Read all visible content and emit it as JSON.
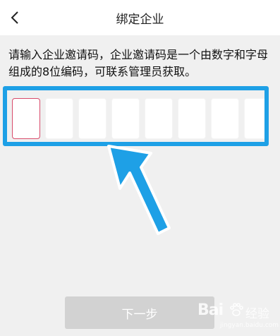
{
  "header": {
    "title": "绑定企业",
    "back_icon": "chevron-left-icon"
  },
  "instruction": "请输入企业邀请码，企业邀请码是一个由数字和字母组成的8位编码，可联系管理员获取。",
  "invite_code": {
    "length": 8,
    "values": [
      "",
      "",
      "",
      "",
      "",
      "",
      "",
      ""
    ],
    "active_index": 0
  },
  "next_button": {
    "label": "下一步"
  },
  "watermark": {
    "brand": "Bai",
    "sub": "经验",
    "url": "jingyan.baidu.com"
  },
  "colors": {
    "highlight_frame": "#1ea0e6",
    "active_cell_border": "#d84a6a",
    "button_disabled": "#d2d2d2",
    "background": "#f0f0f0"
  }
}
